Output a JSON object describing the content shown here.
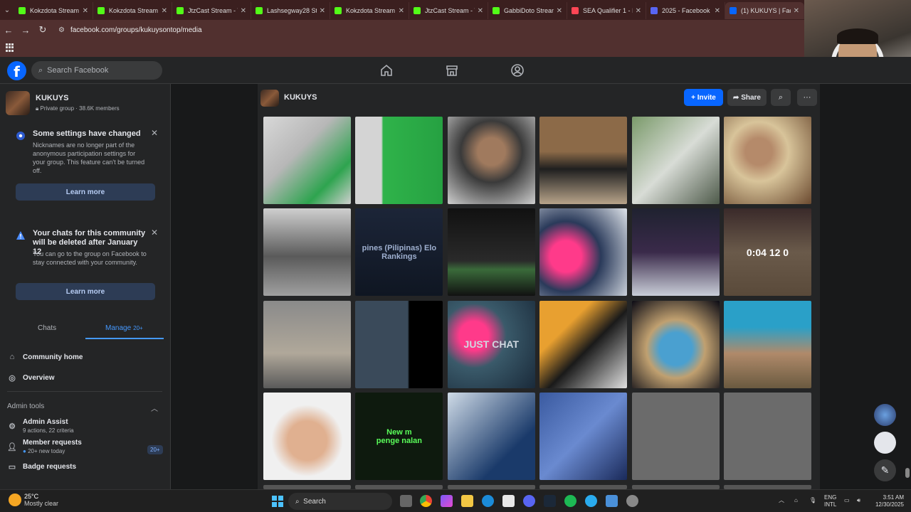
{
  "browser": {
    "tabs": [
      {
        "title": "Kokzdota Stream",
        "color": "#53fc18"
      },
      {
        "title": "Kokzdota Stream",
        "color": "#53fc18"
      },
      {
        "title": "JtzCast Stream - V",
        "color": "#53fc18"
      },
      {
        "title": "Lashsegway28 Str",
        "color": "#53fc18"
      },
      {
        "title": "Kokzdota Stream",
        "color": "#53fc18"
      },
      {
        "title": "JtzCast Stream - V",
        "color": "#53fc18"
      },
      {
        "title": "GabbiDoto Strean",
        "color": "#53fc18"
      },
      {
        "title": "SEA Qualifier 1 - I",
        "color": "#ff4655"
      },
      {
        "title": "2025 - Facebook I",
        "color": "#5865f2"
      },
      {
        "title": "(1) KUKUYS | Face",
        "color": "#0866ff"
      }
    ],
    "url": "facebook.com/groups/kukuysontop/media"
  },
  "facebook": {
    "search_placeholder": "Search Facebook",
    "logo_letter": "f"
  },
  "sidebar": {
    "group_name": "KUKUYS",
    "group_meta": "Private group · 38.6K members",
    "notice1": {
      "title": "Some settings have changed",
      "body": "Nicknames are no longer part of the anonymous participation settings for your group. This feature can't be turned off.",
      "button": "Learn more"
    },
    "notice2": {
      "title": "Your chats for this community will be deleted after January 12",
      "body": "You can go to the group on Facebook to stay connected with your community.",
      "button": "Learn more"
    },
    "tabs": {
      "chats": "Chats",
      "manage": "Manage",
      "manage_badge": "20+"
    },
    "community_home": "Community home",
    "overview": "Overview",
    "admin_tools": "Admin tools",
    "admin_assist": {
      "label": "Admin Assist",
      "sub": "9 actions, 22 criteria"
    },
    "member_requests": {
      "label": "Member requests",
      "sub": "20+ new today",
      "count": "20+"
    },
    "badge_requests": "Badge requests"
  },
  "main": {
    "group_name": "KUKUYS",
    "invite": "Invite",
    "share": "Share",
    "photos": [
      {
        "bg": "linear-gradient(135deg,#d8d8d8,#b7b7b7 40%,#2ea44f 75%,#cfcfcf)",
        "text": ""
      },
      {
        "bg": "linear-gradient(90deg,#d4d4d4 30%,#2fb34a 32%,#26a142)",
        "text": ""
      },
      {
        "bg": "radial-gradient(circle at 50% 40%,#a07a5e 20%,#3a3a3a 45%,#cfcfcf)",
        "text": ""
      },
      {
        "bg": "linear-gradient(180deg,#8c6a48 40%,#1f1f1f 60%,#b8a48a)",
        "text": ""
      },
      {
        "bg": "linear-gradient(135deg,#7a9a6a,#d8dcd6 50%,#4e5a4a)",
        "text": ""
      },
      {
        "bg": "radial-gradient(circle at 40% 40%,#b58a6a 18%,#d8c49a 40%,#6b4a30)",
        "text": ""
      },
      {
        "bg": "linear-gradient(180deg,#cfcfcf,#5a5a5a 55%,#a0a0a0)",
        "text": ""
      },
      {
        "bg": "linear-gradient(180deg,#1c2538,#0f1622)",
        "text": "pines (Pilipinas) Elo Rankings",
        "color": "#9fb0d0"
      },
      {
        "bg": "linear-gradient(180deg,#111,#2a2a2a 60%,#3a6a3a 70%,#111)",
        "text": ""
      },
      {
        "bg": "radial-gradient(circle at 30% 55%,#ff3a8a 20%,#2a3a5a 45%,#dfe4ea)",
        "text": ""
      },
      {
        "bg": "linear-gradient(180deg,#1f2230,#3a2a4a 50%,#c9ced8)",
        "text": ""
      },
      {
        "bg": "linear-gradient(180deg,#3a2a2a,#6a5a4a 50%,#5a4a3a)",
        "text": "0:04  12  0",
        "color": "#ffffff"
      },
      {
        "bg": "linear-gradient(180deg,#8a8a8a,#b0a89a 60%,#5a5a5a)",
        "text": ""
      },
      {
        "bg": "linear-gradient(90deg,#3a4a5a 60%,#000 62%)",
        "text": ""
      },
      {
        "bg": "radial-gradient(circle at 30% 40%,#ff3a8a 18%,#3a5a6a 40%,#1a2a3a)",
        "text": "JUST CHAT",
        "color": "#cfd8e0"
      },
      {
        "bg": "linear-gradient(135deg,#e8a030 30%,#1a1a1a 55%,#e0e0e0)",
        "text": ""
      },
      {
        "bg": "radial-gradient(circle at 50% 55%,#4aa0d0 25%,#c0a070 45%,#0a0a14)",
        "text": ""
      },
      {
        "bg": "linear-gradient(180deg,#2aa0c8 30%,#b08a6a 60%,#6a5a40)",
        "text": ""
      },
      {
        "bg": "radial-gradient(circle at 50% 55%,#e0b090 30%,#f0f0f0 55%)",
        "text": ""
      },
      {
        "bg": "#0e1a0e",
        "text": "New m\npenge nalan",
        "color": "#5aff5a"
      },
      {
        "bg": "linear-gradient(135deg,#d0dce8,#1a3a6a 70%)",
        "text": ""
      },
      {
        "bg": "linear-gradient(135deg,#3a5aa0,#6a8ad0 50%,#1a2a5a)",
        "text": ""
      },
      {
        "bg": "#6b6b6b",
        "text": ""
      },
      {
        "bg": "#6b6b6b",
        "text": ""
      }
    ]
  },
  "taskbar": {
    "temp": "25°C",
    "weather": "Mostly clear",
    "search": "Search",
    "lang1": "ENG",
    "lang2": "INTL",
    "time": "3:51 AM",
    "date": "12/30/2025"
  }
}
